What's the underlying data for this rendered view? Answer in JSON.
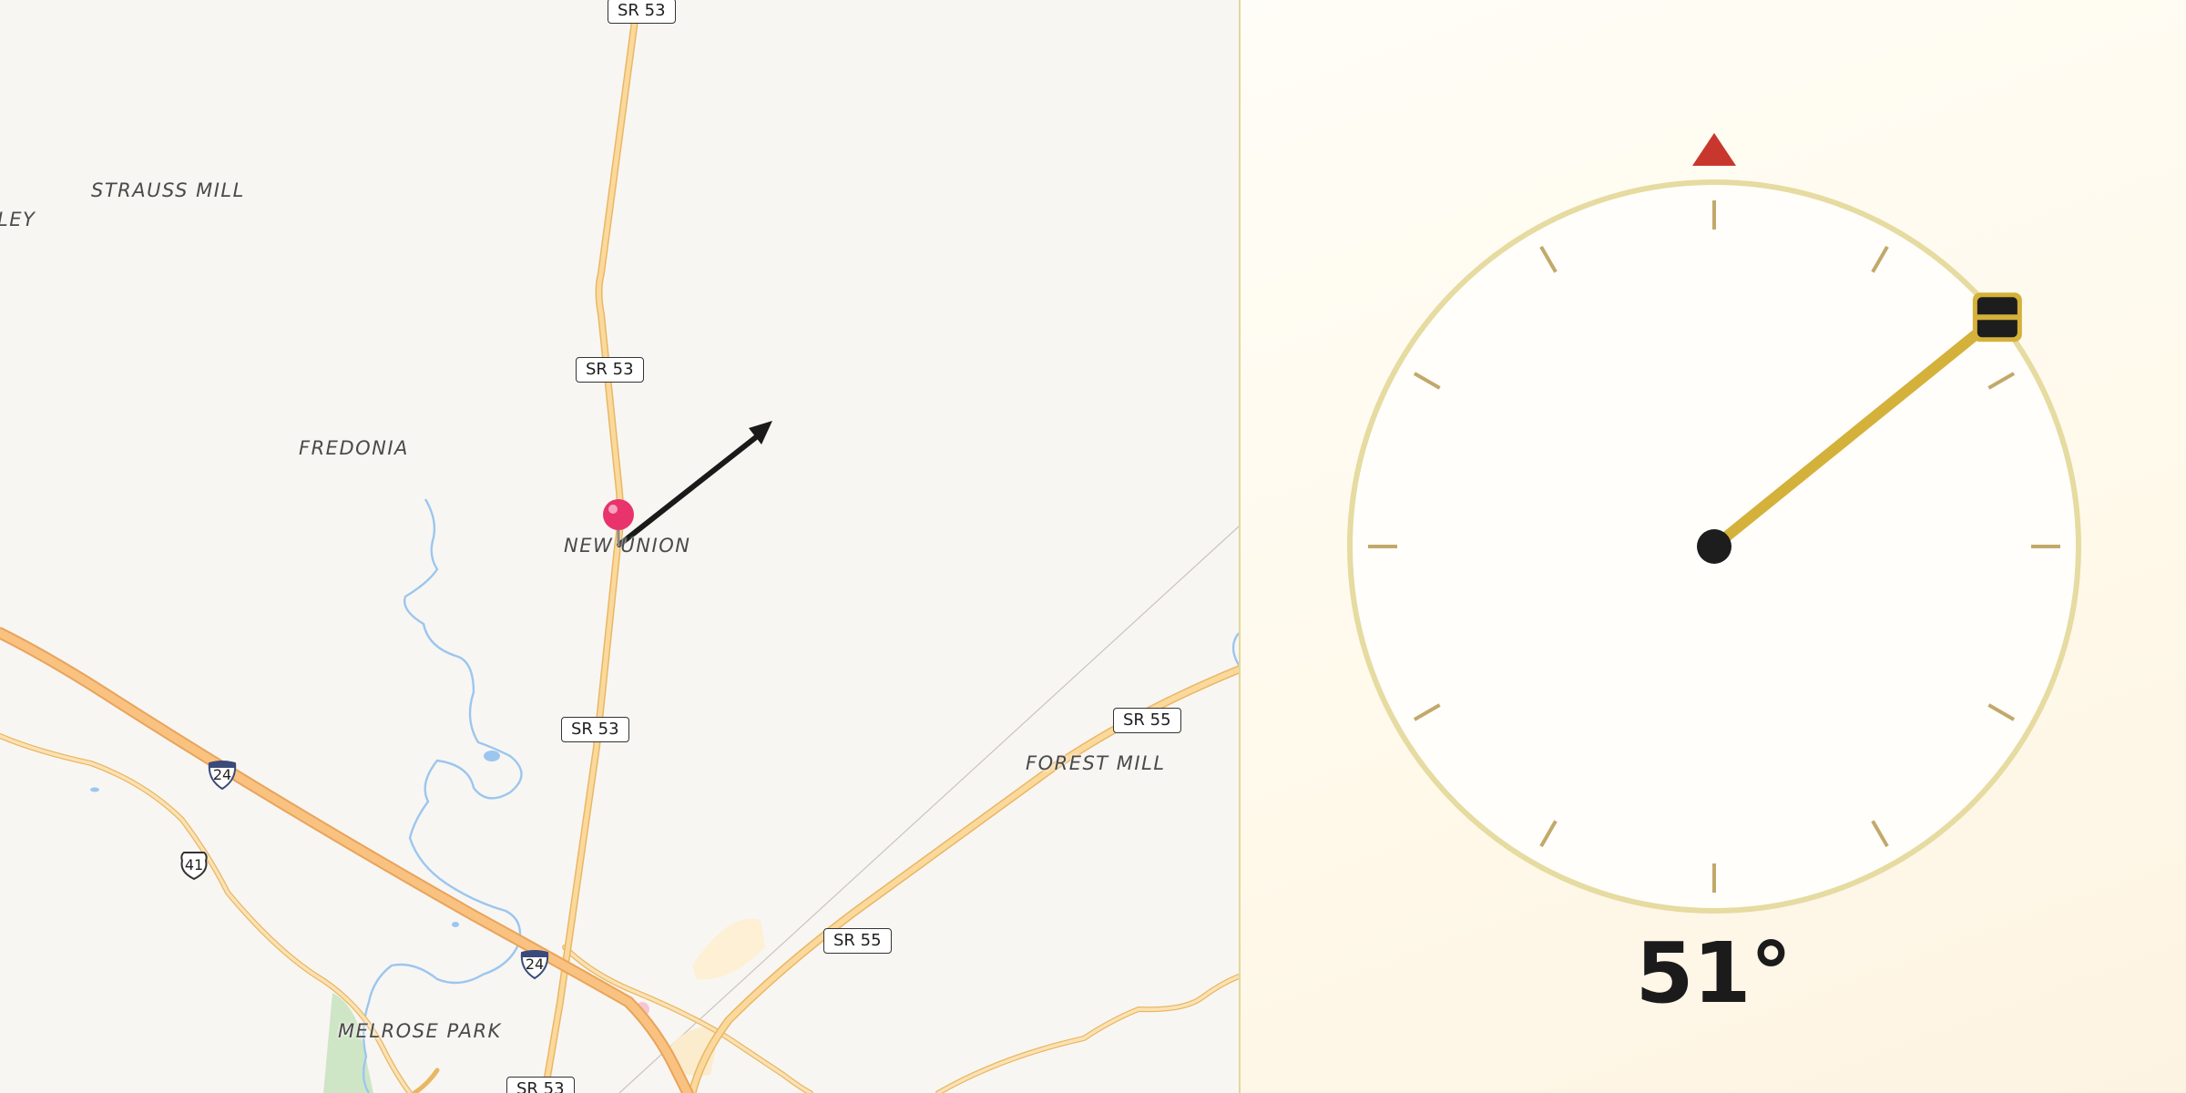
{
  "map": {
    "places": [
      {
        "id": "strauss-mill",
        "label": "STRAUSS MILL"
      },
      {
        "id": "valley",
        "label": "LEY"
      },
      {
        "id": "fredonia",
        "label": "FREDONIA"
      },
      {
        "id": "new-union",
        "label": "NEW UNION"
      },
      {
        "id": "forest-mill",
        "label": "FOREST MILL"
      },
      {
        "id": "melrose-park",
        "label": "MELROSE PARK"
      }
    ],
    "route_shields": [
      {
        "id": "sr53-top",
        "label": "SR 53"
      },
      {
        "id": "sr53-mid",
        "label": "SR 53"
      },
      {
        "id": "sr53-lower",
        "label": "SR 53"
      },
      {
        "id": "sr53-bottom",
        "label": "SR 53"
      },
      {
        "id": "sr55-right",
        "label": "SR 55"
      },
      {
        "id": "sr55-lower",
        "label": "SR 55"
      }
    ],
    "highway_shields": [
      {
        "id": "i24-left",
        "label": "24",
        "type": "interstate"
      },
      {
        "id": "i24-lower",
        "label": "24",
        "type": "interstate"
      },
      {
        "id": "us41",
        "label": "41",
        "type": "us-route"
      }
    ],
    "pin_color": "#e8336d",
    "road_color": "#f6c983",
    "water_color": "#9cc6ef",
    "park_color": "#cfe6c6"
  },
  "compass": {
    "heading_deg": 51,
    "heading_label": "51°",
    "north_marker_color": "#c8372d",
    "needle_color": "#d4b13a",
    "ring_color": "#e6dba0"
  }
}
